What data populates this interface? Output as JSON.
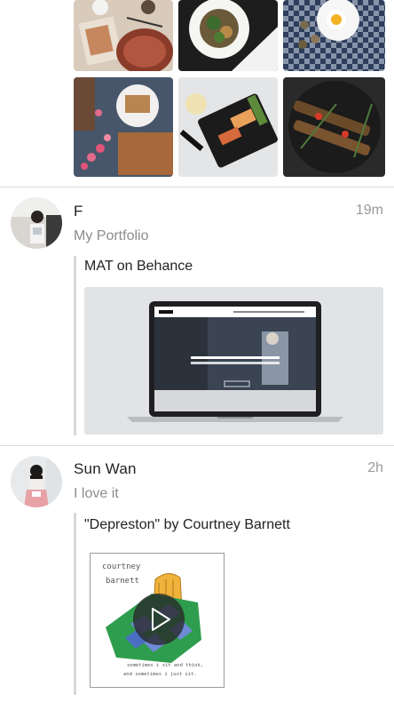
{
  "grid": {
    "photos": [
      {
        "name": "photo-breakfast-table",
        "description_icon": "photo-icon"
      },
      {
        "name": "photo-plated-dish",
        "description_icon": "photo-icon"
      },
      {
        "name": "photo-egg-checkered",
        "description_icon": "photo-icon"
      },
      {
        "name": "photo-tart-berries",
        "description_icon": "photo-icon"
      },
      {
        "name": "photo-salmon-tray",
        "description_icon": "photo-icon"
      },
      {
        "name": "photo-skewers-pan",
        "description_icon": "photo-icon"
      }
    ]
  },
  "posts": [
    {
      "author": "F",
      "time": "19m",
      "text": "My Portfolio",
      "link_title": "MAT on Behance",
      "preview_icon": "laptop-icon"
    },
    {
      "author": "Sun Wan",
      "time": "2h",
      "text": "I love it",
      "link_title": "\"Depreston\" by Courtney Barnett",
      "album_art": {
        "artist_line_1": "courtney",
        "artist_line_2": "barnett",
        "tagline_line_1": "sometimes i sit and think,",
        "tagline_line_2": "and sometimes i just sit."
      },
      "play_icon": "play-icon"
    }
  ],
  "colors": {
    "divider": "#dcdcdc",
    "muted_text": "#8c8c8c",
    "time_text": "#9a9a9a"
  }
}
